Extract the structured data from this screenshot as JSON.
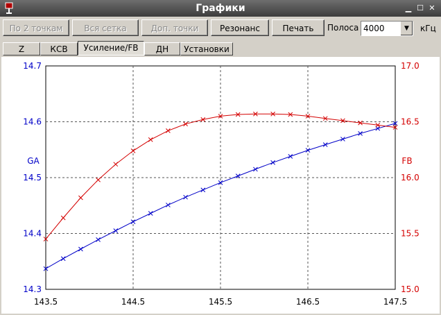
{
  "window": {
    "title": "Графики"
  },
  "toolbar": {
    "buttons": [
      "По 2 точкам",
      "Вся сетка",
      "Доп. точки",
      "Резонанс",
      "Печать"
    ],
    "band_label": "Полоса",
    "band_value": "4000",
    "unit_label": "кГц"
  },
  "tabs": [
    "Z",
    "КСВ",
    "Усиление/FB",
    "ДН",
    "Установки"
  ],
  "active_tab": "Усиление/FB",
  "colors": {
    "ga": "#0000c8",
    "fb": "#d40000"
  },
  "chart_data": {
    "type": "line",
    "x_ticks": [
      "143.5",
      "144.5",
      "145.5",
      "146.5",
      "147.5"
    ],
    "xlim": [
      143.5,
      147.5
    ],
    "left_axis": {
      "label": "GA",
      "ylim": [
        14.3,
        14.7
      ],
      "ticks": [
        "14.3",
        "14.4",
        "14.5",
        "14.6",
        "14.7"
      ]
    },
    "right_axis": {
      "label": "FB",
      "ylim": [
        15.0,
        17.0
      ],
      "ticks": [
        "15.0",
        "15.5",
        "16.0",
        "16.5",
        "17.0"
      ]
    },
    "grid": true,
    "series": [
      {
        "name": "GA",
        "axis": "left",
        "x": [
          143.5,
          143.7,
          143.9,
          144.1,
          144.3,
          144.5,
          144.7,
          144.9,
          145.1,
          145.3,
          145.5,
          145.7,
          145.9,
          146.1,
          146.3,
          146.5,
          146.7,
          146.9,
          147.1,
          147.3,
          147.5
        ],
        "values": [
          14.337,
          14.355,
          14.372,
          14.389,
          14.405,
          14.421,
          14.436,
          14.451,
          14.465,
          14.478,
          14.491,
          14.503,
          14.515,
          14.527,
          14.538,
          14.549,
          14.559,
          14.569,
          14.579,
          14.588,
          14.597
        ]
      },
      {
        "name": "FB",
        "axis": "right",
        "x": [
          143.5,
          143.7,
          143.9,
          144.1,
          144.3,
          144.5,
          144.7,
          144.9,
          145.1,
          145.3,
          145.5,
          145.7,
          145.9,
          146.1,
          146.3,
          146.5,
          146.7,
          146.9,
          147.1,
          147.3,
          147.5
        ],
        "values": [
          15.45,
          15.64,
          15.82,
          15.98,
          16.12,
          16.24,
          16.34,
          16.42,
          16.48,
          16.52,
          16.55,
          16.565,
          16.57,
          16.57,
          16.565,
          16.55,
          16.53,
          16.51,
          16.49,
          16.47,
          16.45
        ]
      }
    ]
  }
}
